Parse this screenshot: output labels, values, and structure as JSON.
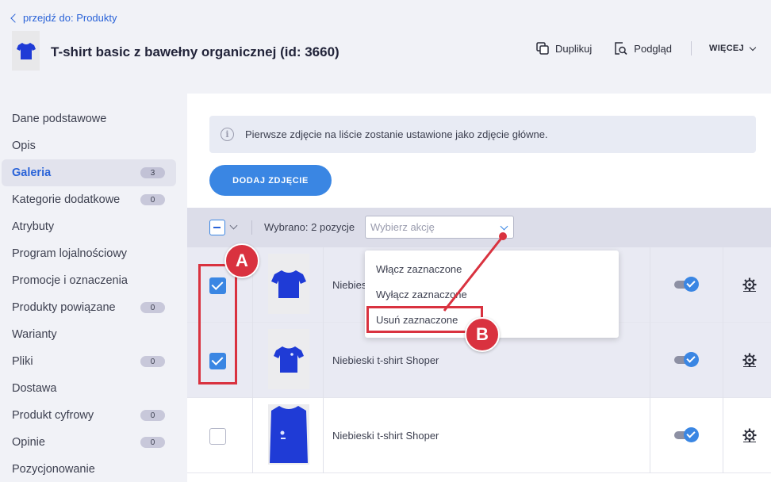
{
  "header": {
    "back_link": "przejdź do: Produkty",
    "title": "T-shirt basic z bawełny organicznej (id: 3660)",
    "actions": {
      "duplicate": "Duplikuj",
      "preview": "Podgląd",
      "more": "WIĘCEJ"
    }
  },
  "sidebar": {
    "items": [
      {
        "label": "Dane podstawowe"
      },
      {
        "label": "Opis"
      },
      {
        "label": "Galeria",
        "badge": "3",
        "active": true
      },
      {
        "label": "Kategorie dodatkowe",
        "badge": "0"
      },
      {
        "label": "Atrybuty"
      },
      {
        "label": "Program lojalnościowy"
      },
      {
        "label": "Promocje i oznaczenia"
      },
      {
        "label": "Produkty powiązane",
        "badge": "0"
      },
      {
        "label": "Warianty"
      },
      {
        "label": "Pliki",
        "badge": "0"
      },
      {
        "label": "Dostawa"
      },
      {
        "label": "Produkt cyfrowy",
        "badge": "0"
      },
      {
        "label": "Opinie",
        "badge": "0"
      },
      {
        "label": "Pozycjonowanie"
      }
    ]
  },
  "main": {
    "info": "Pierwsze zdjęcie na liście zostanie ustawione jako zdjęcie główne.",
    "add_button": "DODAJ ZDJĘCIE",
    "toolbar": {
      "selected_text": "Wybrano: 2 pozycje",
      "action_placeholder": "Wybierz akcję"
    },
    "rows": [
      {
        "name": "Niebieski t-shirt Shoper",
        "visible_name": "Niebies",
        "checked": true
      },
      {
        "name": "Niebieski t-shirt Shoper",
        "checked": true
      },
      {
        "name": "Niebieski t-shirt Shoper",
        "checked": false
      }
    ],
    "dropdown": {
      "options": [
        "Włącz zaznaczone",
        "Wyłącz zaznaczone",
        "Usuń zaznaczone"
      ]
    }
  },
  "annotations": {
    "a": "A",
    "b": "B"
  },
  "colors": {
    "accent": "#3a86e3",
    "link": "#2a63d8",
    "marker": "#d9323f",
    "toolbar_bg": "#dcdde9"
  }
}
